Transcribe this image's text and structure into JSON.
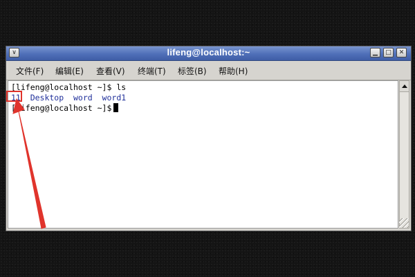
{
  "window": {
    "title": "lifeng@localhost:~",
    "menu_button_glyph": "∨",
    "minimize_glyph": "▁",
    "maximize_glyph": "□",
    "close_glyph": "✕"
  },
  "menubar": {
    "items": [
      {
        "label": "文件(F)"
      },
      {
        "label": "编辑(E)"
      },
      {
        "label": "查看(V)"
      },
      {
        "label": "终端(T)"
      },
      {
        "label": "标签(B)"
      },
      {
        "label": "帮助(H)"
      }
    ]
  },
  "terminal": {
    "lines": [
      "[lifeng@localhost ~]$ ls",
      "11  Desktop  word  word1",
      "[lifeng@localhost ~]$"
    ]
  },
  "annotation": {
    "color": "#e0342c"
  }
}
